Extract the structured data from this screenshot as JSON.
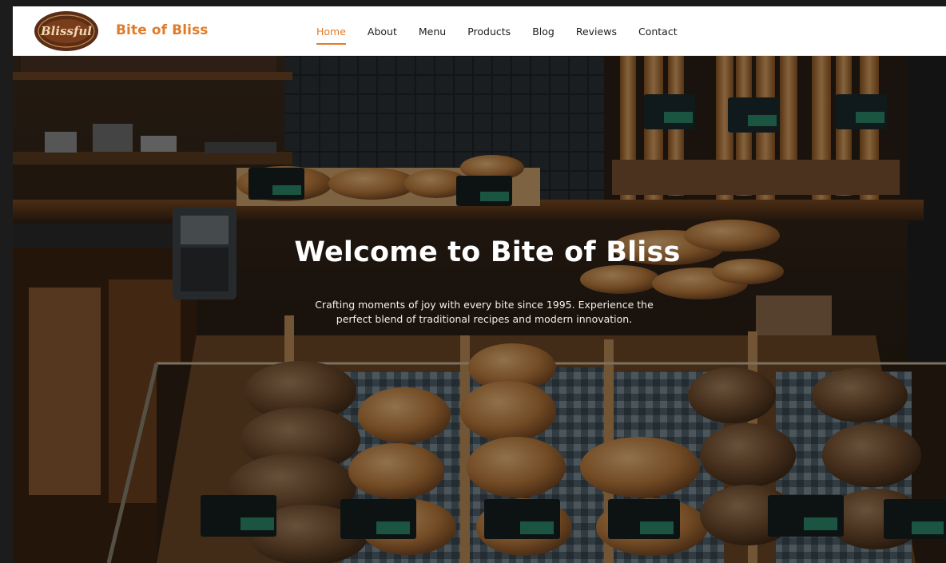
{
  "header": {
    "logo_text": "Blissful",
    "brand_name": "Bite of Bliss"
  },
  "nav": {
    "items": [
      {
        "label": "Home",
        "active": true
      },
      {
        "label": "About",
        "active": false
      },
      {
        "label": "Menu",
        "active": false
      },
      {
        "label": "Products",
        "active": false
      },
      {
        "label": "Blog",
        "active": false
      },
      {
        "label": "Reviews",
        "active": false
      },
      {
        "label": "Contact",
        "active": false
      }
    ]
  },
  "hero": {
    "title": "Welcome to Bite of Bliss",
    "subtitle": "Crafting moments of joy with every bite since 1995. Experience the perfect blend of traditional recipes and modern innovation.",
    "background": "bakery-display-photo"
  },
  "colors": {
    "accent": "#e07b2a",
    "nav_text": "#1d1d1d",
    "hero_text": "#ffffff"
  }
}
